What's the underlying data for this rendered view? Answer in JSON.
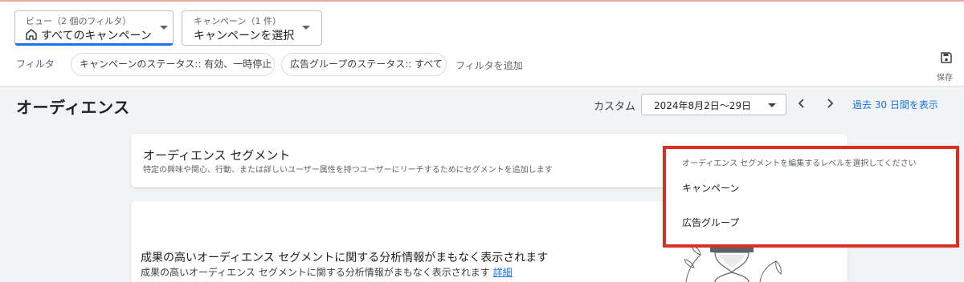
{
  "header": {
    "view_dropdown": {
      "caption": "ビュー（2 個のフィルタ）",
      "value": "すべてのキャンペーン"
    },
    "campaign_dropdown": {
      "caption": "キャンペーン（1 件）",
      "value": "キャンペーンを選択"
    },
    "save_label": "保存"
  },
  "filters": {
    "label": "フィルタ",
    "chips": [
      "キャンペーンのステータス:: 有効、一時停止",
      "広告グループのステータス:: すべて"
    ],
    "add_label": "フィルタを追加"
  },
  "page": {
    "title": "オーディエンス",
    "date_label": "カスタム",
    "date_range": "2024年8月2日～29日",
    "last30_link": "過去 30 日間を表示"
  },
  "segment_card": {
    "title": "オーディエンス セグメント",
    "description": "特定の興味や関心、行動、または詳しいユーザー属性を持つユーザーにリーチするためにセグメントを追加します"
  },
  "insight_card": {
    "title": "成果の高いオーディエンス セグメントに関する分析情報がまもなく表示されます",
    "description": "成果の高いオーディエンス セグメントに関する分析情報がまもなく表示されます",
    "link": "詳細"
  },
  "level_menu": {
    "header": "オーディエンス セグメントを編集するレベルを選択してください",
    "items": [
      "キャンペーン",
      "広告グループ"
    ]
  },
  "colors": {
    "accent": "#1a73e8",
    "highlight": "#d93025"
  }
}
